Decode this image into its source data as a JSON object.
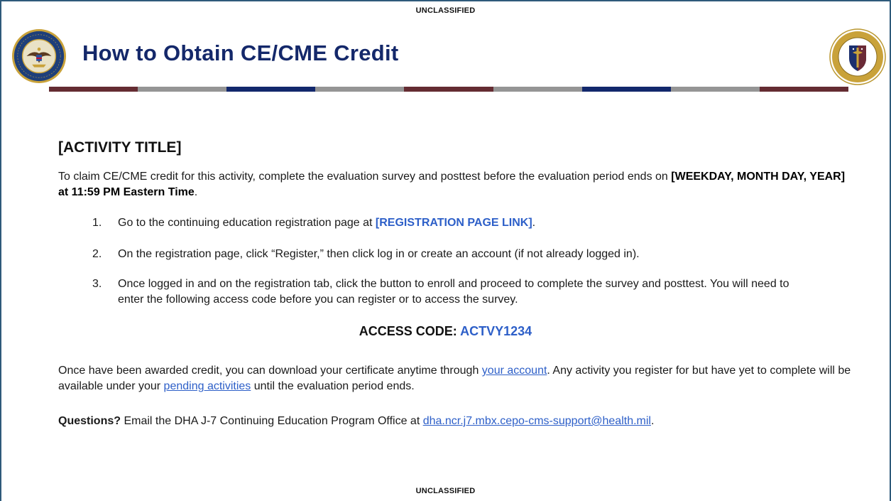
{
  "classification": {
    "top": "UNCLASSIFIED",
    "bottom": "UNCLASSIFIED"
  },
  "header": {
    "title": "How to Obtain CE/CME Credit",
    "left_seal_icon": "dod-seal-icon",
    "right_seal_icon": "dha-seal-icon",
    "left_seal_text": "DEPARTMENT OF DEFENSE · UNITED STATES OF AMERICA",
    "right_seal_text": "DEFENSE HEALTH AGENCY · DEPARTMENT OF DEFENSE",
    "stripe_colors": [
      "#642c32",
      "#959595",
      "#12286c"
    ]
  },
  "content": {
    "activity_title": "[ACTIVITY TITLE]",
    "intro_text": "To claim CE/CME credit for this activity, complete the evaluation survey and posttest before the evaluation period ends on ",
    "intro_deadline": "[WEEKDAY, MONTH DAY, YEAR] at 11:59 PM Eastern Time",
    "intro_end": ".",
    "steps": [
      {
        "num": "1.",
        "text": "Go to the continuing education registration page at ",
        "link": "[REGISTRATION PAGE LINK]",
        "end": "."
      },
      {
        "num": "2.",
        "text": "On the registration page, click “Register,” then click log in or create an account (if not already logged in)."
      },
      {
        "num": "3.",
        "text": "Once logged in and on the registration tab, click the button to enroll and proceed to complete the survey and posttest. You will need to enter the following access code before you can register or to access the survey."
      }
    ],
    "access_label": "ACCESS CODE: ",
    "access_code": "ACTVY1234",
    "outro_1": "Once have been awarded credit, you can download your certificate anytime through ",
    "outro_link_1": "your account",
    "outro_2": ". Any activity you register for but have yet to complete will be available under your ",
    "outro_link_2": "pending activities",
    "outro_3": " until the evaluation period ends.",
    "questions_label": "Questions?",
    "questions_text": " Email the DHA J-7 Continuing Education Program Office at ",
    "questions_email": "dha.ncr.j7.mbx.cepo-cms-support@health.mil",
    "questions_end": "."
  },
  "colors": {
    "title_navy": "#14286a",
    "link_blue": "#2d5fc8",
    "maroon": "#642c32",
    "gray": "#959595",
    "navy": "#12286c"
  }
}
